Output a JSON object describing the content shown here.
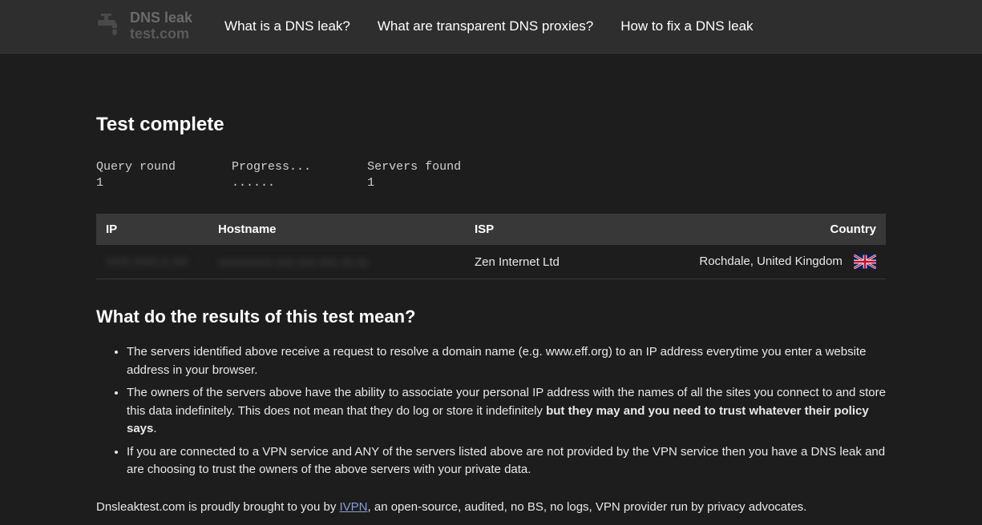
{
  "logo": {
    "line1": "DNS leak",
    "line2": "test.com"
  },
  "nav": {
    "link1": "What is a DNS leak?",
    "link2": "What are transparent DNS proxies?",
    "link3": "How to fix a DNS leak"
  },
  "title": "Test complete",
  "status": {
    "query_label": "Query round",
    "query_value": "1",
    "progress_label": "Progress...",
    "progress_value": "......",
    "servers_label": "Servers found",
    "servers_value": "1"
  },
  "table": {
    "headers": {
      "ip": "IP",
      "hostname": "Hostname",
      "isp": "ISP",
      "country": "Country"
    },
    "row": {
      "ip": "XXX.XXX.X.XX",
      "hostname": "xxxxxxxxx-xxx.xxx-xxx.xx.xx",
      "isp": "Zen Internet Ltd",
      "country": "Rochdale, United Kingdom"
    }
  },
  "explain": {
    "title": "What do the results of this test mean?",
    "bullet1": "The servers identified above receive a request to resolve a domain name (e.g. www.eff.org) to an IP address everytime you enter a website address in your browser.",
    "bullet2_a": "The owners of the servers above have the ability to associate your personal IP address with the names of all the sites you connect to and store this data indefinitely. This does not mean that they do log or store it indefinitely ",
    "bullet2_b": "but they may and you need to trust whatever their policy says",
    "bullet2_c": ".",
    "bullet3": "If you are connected to a VPN service and ANY of the servers listed above are not provided by the VPN service then you have a DNS leak and are choosing to trust the owners of the above servers with your private data."
  },
  "footer": {
    "pre": "Dnsleaktest.com is proudly brought to you by ",
    "link": "IVPN",
    "post": ", an open-source, audited, no BS, no logs, VPN provider run by privacy advocates."
  }
}
